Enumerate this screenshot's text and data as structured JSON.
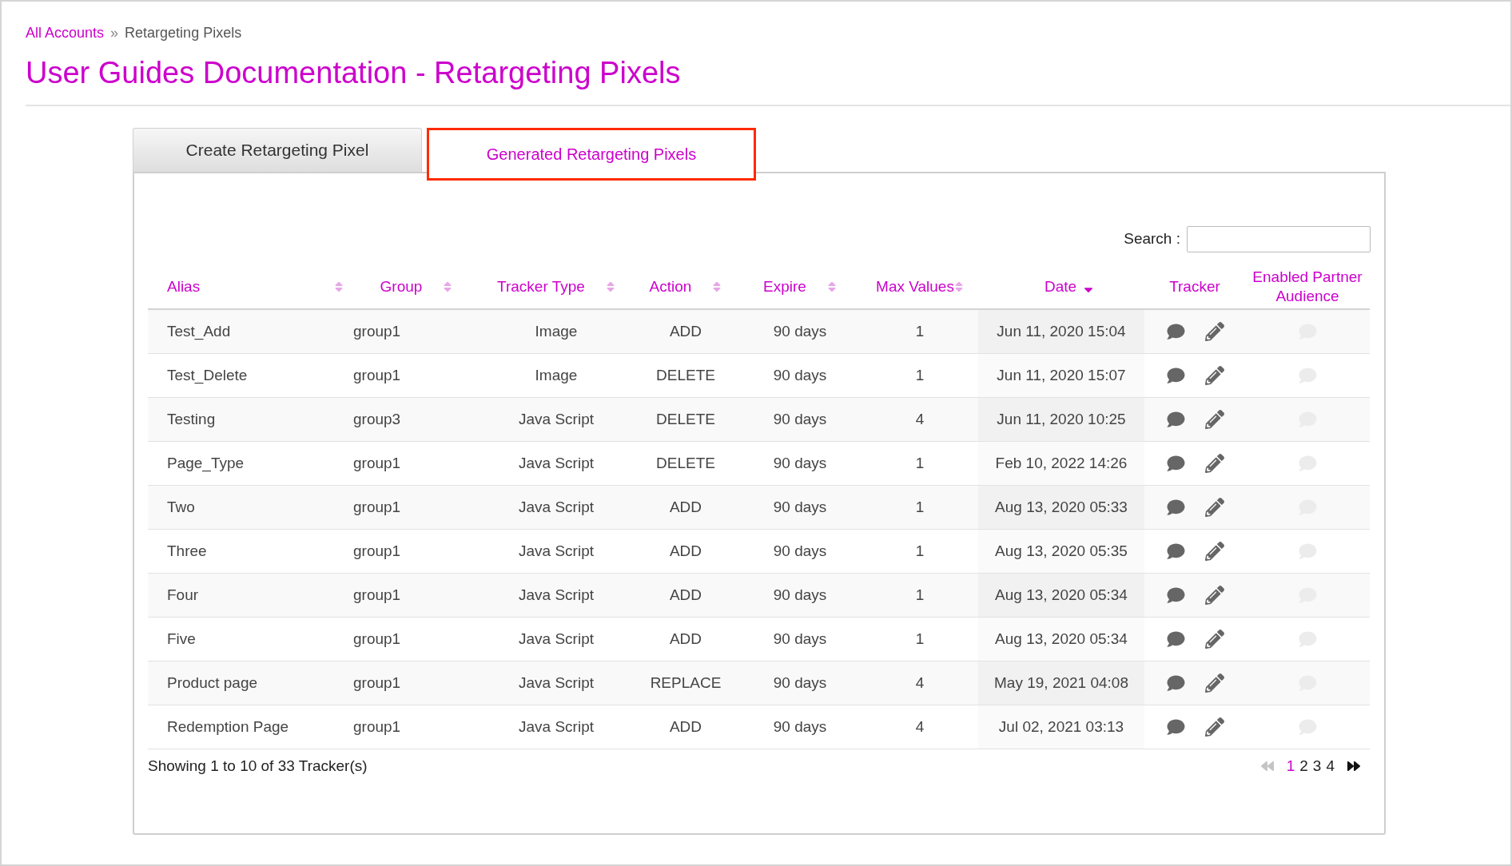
{
  "breadcrumb": {
    "link": "All Accounts",
    "separator": "»",
    "current": "Retargeting Pixels"
  },
  "title": "User Guides Documentation - Retargeting Pixels",
  "tabs": [
    {
      "label": "Create Retargeting Pixel",
      "selected": false
    },
    {
      "label": "Generated Retargeting Pixels",
      "selected": true
    }
  ],
  "search": {
    "label": "Search :"
  },
  "table": {
    "columns": [
      {
        "label": "Alias",
        "sorted": false
      },
      {
        "label": "Group",
        "sorted": false
      },
      {
        "label": "Tracker Type",
        "sorted": false
      },
      {
        "label": "Action",
        "sorted": false
      },
      {
        "label": "Expire",
        "sorted": false
      },
      {
        "label": "Max Values",
        "sorted": false
      },
      {
        "label": "Date",
        "sorted": true
      },
      {
        "label": "Tracker"
      },
      {
        "label": "Enabled Partner Audience"
      }
    ],
    "rows": [
      {
        "alias": "Test_Add",
        "group": "group1",
        "tracker_type": "Image",
        "action": "ADD",
        "expire": "90 days",
        "max_values": "1",
        "date": "Jun 11, 2020 15:04",
        "partner_audience": false
      },
      {
        "alias": "Test_Delete",
        "group": "group1",
        "tracker_type": "Image",
        "action": "DELETE",
        "expire": "90 days",
        "max_values": "1",
        "date": "Jun 11, 2020 15:07",
        "partner_audience": false
      },
      {
        "alias": "Testing",
        "group": "group3",
        "tracker_type": "Java Script",
        "action": "DELETE",
        "expire": "90 days",
        "max_values": "4",
        "date": "Jun 11, 2020 10:25",
        "partner_audience": false
      },
      {
        "alias": "Page_Type",
        "group": "group1",
        "tracker_type": "Java Script",
        "action": "DELETE",
        "expire": "90 days",
        "max_values": "1",
        "date": "Feb 10, 2022 14:26",
        "partner_audience": false
      },
      {
        "alias": "Two",
        "group": "group1",
        "tracker_type": "Java Script",
        "action": "ADD",
        "expire": "90 days",
        "max_values": "1",
        "date": "Aug 13, 2020 05:33",
        "partner_audience": false
      },
      {
        "alias": "Three",
        "group": "group1",
        "tracker_type": "Java Script",
        "action": "ADD",
        "expire": "90 days",
        "max_values": "1",
        "date": "Aug 13, 2020 05:35",
        "partner_audience": false
      },
      {
        "alias": "Four",
        "group": "group1",
        "tracker_type": "Java Script",
        "action": "ADD",
        "expire": "90 days",
        "max_values": "1",
        "date": "Aug 13, 2020 05:34",
        "partner_audience": false
      },
      {
        "alias": "Five",
        "group": "group1",
        "tracker_type": "Java Script",
        "action": "ADD",
        "expire": "90 days",
        "max_values": "1",
        "date": "Aug 13, 2020 05:34",
        "partner_audience": false
      },
      {
        "alias": "Product page",
        "group": "group1",
        "tracker_type": "Java Script",
        "action": "REPLACE",
        "expire": "90 days",
        "max_values": "4",
        "date": "May 19, 2021 04:08",
        "partner_audience": false
      },
      {
        "alias": "Redemption Page",
        "group": "group1",
        "tracker_type": "Java Script",
        "action": "ADD",
        "expire": "90 days",
        "max_values": "4",
        "date": "Jul 02, 2021 03:13",
        "partner_audience": false
      }
    ]
  },
  "footer": {
    "info": "Showing 1 to 10 of 33 Tracker(s)",
    "previous_disabled": true,
    "next_disabled": false,
    "pages": [
      {
        "label": "1",
        "selected": true
      },
      {
        "label": "2",
        "selected": false
      },
      {
        "label": "3",
        "selected": false
      },
      {
        "label": "4",
        "selected": false
      }
    ]
  }
}
